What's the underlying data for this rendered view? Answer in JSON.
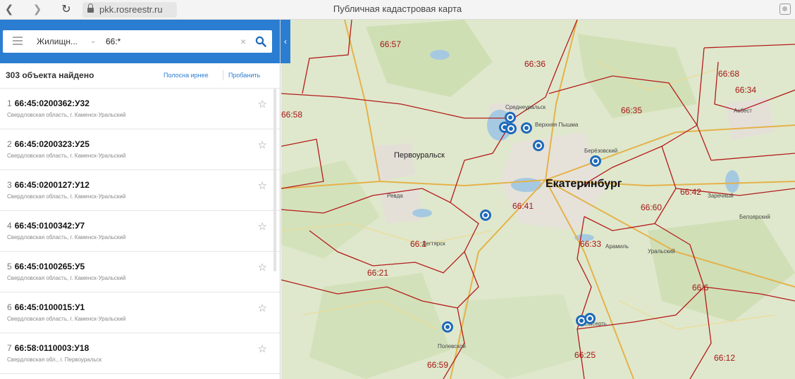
{
  "browser": {
    "url": "pkk.rosreestr.ru",
    "title": "Публичная кадастровая карта"
  },
  "search": {
    "category": "Жилищн...",
    "query": "66:*"
  },
  "results_header": {
    "count": "303 объекта найдено",
    "link_1": "Полосна ирнее",
    "link_2": "Пробанить"
  },
  "results": [
    {
      "num": "1",
      "cad": "66:45:0200362:У32",
      "sub": "Свердловская область, г. Каменск-Уральский"
    },
    {
      "num": "2",
      "cad": "66:45:0200323:У25",
      "sub": "Свердловская область, г. Каменск-Уральский"
    },
    {
      "num": "3",
      "cad": "66:45:0200127:У12",
      "sub": "Свердловская область, г. Каменск-Уральский"
    },
    {
      "num": "4",
      "cad": "66:45:0100342:У7",
      "sub": "Свердловская область, г. Каменск-Уральский"
    },
    {
      "num": "5",
      "cad": "66:45:0100265:У5",
      "sub": "Свердловская область, г. Каменск-Уральский"
    },
    {
      "num": "6",
      "cad": "66:45:0100015:У1",
      "sub": "Свердловская область, г. Каменск-Уральский"
    },
    {
      "num": "7",
      "cad": "66:58:0110003:У18",
      "sub": "Свердловская обл., г. Первоуральск"
    }
  ],
  "map": {
    "districts": [
      "66:57",
      "66:36",
      "66:68",
      "66:34",
      "66:58",
      "66:35",
      "66:41",
      "66:42",
      "66:60",
      "66:1",
      "66:21",
      "66:33",
      "66:6",
      "66:59",
      "66:25",
      "66:12"
    ],
    "cities": {
      "main": "Екатеринбург",
      "pervouralsk": "Первоуральск",
      "berezovsky": "Берёзовский",
      "verkhnyaya_pyshma": "Верхняя Пышма",
      "revda": "Ревда",
      "polevskoy": "Полевской",
      "degtyarsk": "Дегтярск",
      "aramil": "Арамиль",
      "zarechny": "Заречный",
      "asbest": "Асбест",
      "sredneuralsk": "Среднеуральск",
      "beloyarsky": "Белоярский",
      "sysert": "Сысерть",
      "uralsky": "Уральский"
    }
  }
}
